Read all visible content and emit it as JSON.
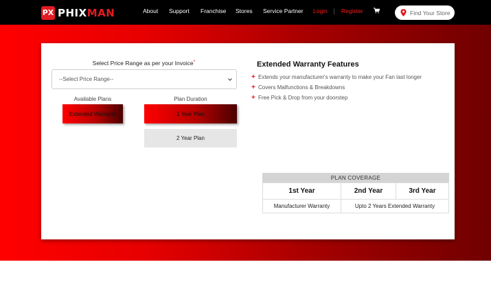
{
  "brand": {
    "mark": "PX",
    "name_part1": "PHIX",
    "name_part2": "MAN",
    "accent_color": "#e21b23"
  },
  "nav": {
    "items": [
      "About",
      "Support",
      "Franchise",
      "Stores",
      "Service Partner"
    ],
    "login": "Login",
    "register": "Register",
    "cart_icon": "cart-icon"
  },
  "store_search": {
    "label": "Find Your Store",
    "icon": "map-pin-icon"
  },
  "form": {
    "price_label": "Select Price Range as per your Invoice",
    "required_mark": "*",
    "price_select_value": "--Select Price Range--",
    "available_plans_label": "Available Plans",
    "plan_duration_label": "Plan Duration",
    "plan_button": "Extended Warranty",
    "duration_options": [
      "1 Year Plan",
      "2 Year Plan"
    ]
  },
  "features": {
    "title": "Extended Warranty Features",
    "items": [
      "Extends your manufacturer's warranty to make your Fan last longer",
      "Covers Malfunctions & Breakdowns",
      "Free Pick & Drop from your doorstep"
    ]
  },
  "coverage": {
    "header": "PLAN COVERAGE",
    "years": [
      "1st Year",
      "2nd Year",
      "3rd Year"
    ],
    "row": [
      "Manufacturer Warranty",
      "Upto 2 Years Extended Warranty"
    ]
  }
}
